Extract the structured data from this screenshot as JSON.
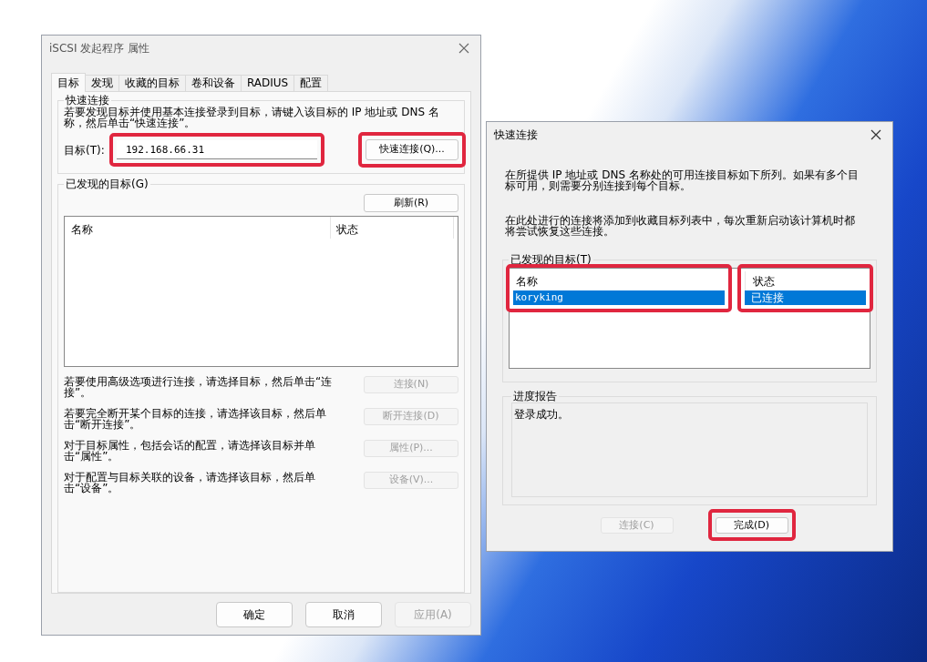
{
  "main_window": {
    "title": "iSCSI 发起程序 属性",
    "tabs": [
      {
        "label": "目标",
        "selected": true
      },
      {
        "label": "发现",
        "selected": false
      },
      {
        "label": "收藏的目标",
        "selected": false
      },
      {
        "label": "卷和设备",
        "selected": false
      },
      {
        "label": "RADIUS",
        "selected": false
      },
      {
        "label": "配置",
        "selected": false
      }
    ],
    "quick_connect": {
      "label": "快速连接",
      "description": "若要发现目标并使用基本连接登录到目标，请键入该目标的 IP 地址或 DNS 名称，然后单击“快速连接”。",
      "target_label": "目标(T):",
      "target_value": "192.168.66.31",
      "target_highlighted": true,
      "button": {
        "label": "快速连接(Q)...",
        "disabled": false,
        "highlighted": true
      }
    },
    "discovered": {
      "label": "已发现的目标(G)",
      "refresh_button": {
        "label": "刷新(R)",
        "disabled": false
      },
      "columns": [
        {
          "label": "名称"
        },
        {
          "label": "状态"
        }
      ]
    },
    "actions": [
      {
        "text": "若要使用高级选项进行连接，请选择目标，然后单击“连接”。",
        "button": {
          "label": "连接(N)",
          "disabled": true
        }
      },
      {
        "text": "若要完全断开某个目标的连接，请选择该目标，然后单击“断开连接”。",
        "button": {
          "label": "断开连接(D)",
          "disabled": true
        }
      },
      {
        "text": "对于目标属性，包括会话的配置，请选择该目标并单击“属性”。",
        "button": {
          "label": "属性(P)...",
          "disabled": true
        }
      },
      {
        "text": "对于配置与目标关联的设备，请选择该目标，然后单击“设备”。",
        "button": {
          "label": "设备(V)...",
          "disabled": true
        }
      }
    ],
    "footer_buttons": [
      {
        "label": "确定",
        "disabled": false
      },
      {
        "label": "取消",
        "disabled": false
      },
      {
        "label": "应用(A)",
        "disabled": true
      }
    ]
  },
  "quick_connect_dialog": {
    "title": "快速连接",
    "paragraphs": [
      "在所提供 IP 地址或 DNS 名称处的可用连接目标如下所列。如果有多个目标可用，则需要分别连接到每个目标。",
      "在此处进行的连接将添加到收藏目标列表中，每次重新启动该计算机时都将尝试恢复这些连接。"
    ],
    "discovered": {
      "label": "已发现的目标(T)",
      "columns": [
        {
          "label": "名称",
          "highlighted": true
        },
        {
          "label": "状态",
          "highlighted": true
        }
      ],
      "rows": [
        {
          "cells": [
            "koryking",
            "已连接"
          ],
          "selected": true
        }
      ]
    },
    "progress": {
      "label": "进度报告",
      "text": "登录成功。"
    },
    "buttons": [
      {
        "label": "连接(C)",
        "disabled": true,
        "highlighted": false
      },
      {
        "label": "完成(D)",
        "disabled": false,
        "highlighted": true
      }
    ]
  }
}
